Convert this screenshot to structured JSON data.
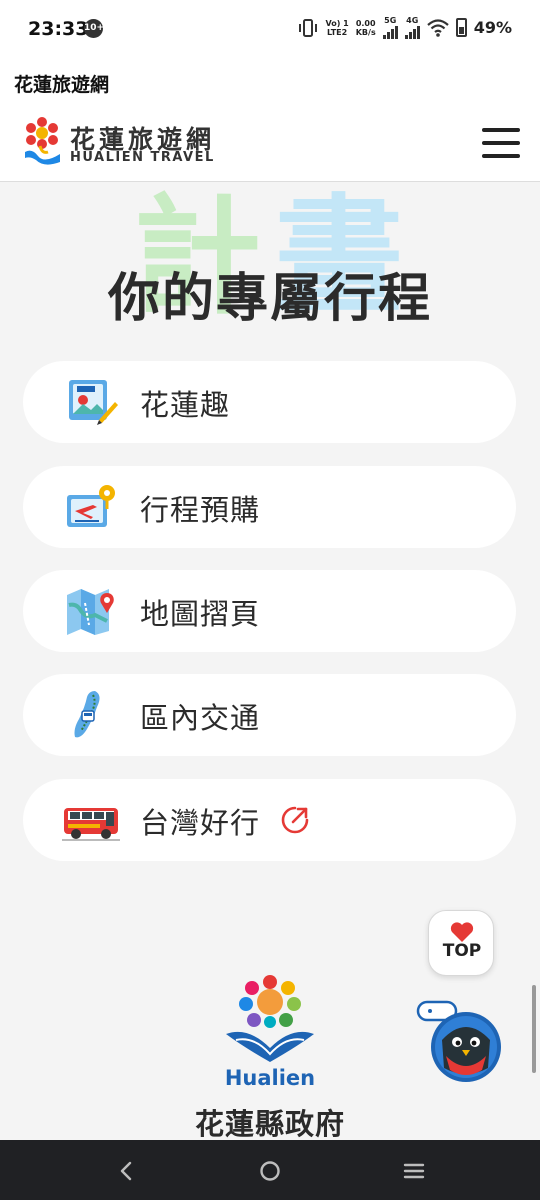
{
  "status_bar": {
    "time": "23:33",
    "notification_badge": "10+",
    "volte_line1": "Vo) 1",
    "volte_line2": "LTE2",
    "speed_value": "0.00",
    "speed_unit": "KB/s",
    "net1": "5G",
    "net2": "4G",
    "battery": "49%"
  },
  "header": {
    "page_title": "花蓮旅遊網",
    "logo_cn": "花蓮旅遊網",
    "logo_en": "HUALIEN TRAVEL"
  },
  "hero": {
    "bg_word_1": "計",
    "bg_word_2": "畫",
    "title": "你的專屬行程"
  },
  "menu": [
    {
      "label": "花蓮趣",
      "icon": "photo-album-icon"
    },
    {
      "label": "行程預購",
      "icon": "booking-ticket-icon"
    },
    {
      "label": "地圖摺頁",
      "icon": "folded-map-icon"
    },
    {
      "label": "區內交通",
      "icon": "island-transport-icon"
    },
    {
      "label": "台灣好行",
      "icon": "tourist-bus-icon",
      "external": true
    }
  ],
  "top_button": {
    "label": "TOP"
  },
  "footer": {
    "gov_en": "Hualien",
    "gov_cn": "花蓮縣政府"
  },
  "colors": {
    "accent_red": "#e53935",
    "gov_blue": "#1e64b4",
    "bg_word_green": "#c8ecc3",
    "bg_word_blue": "#c3e6f7"
  }
}
